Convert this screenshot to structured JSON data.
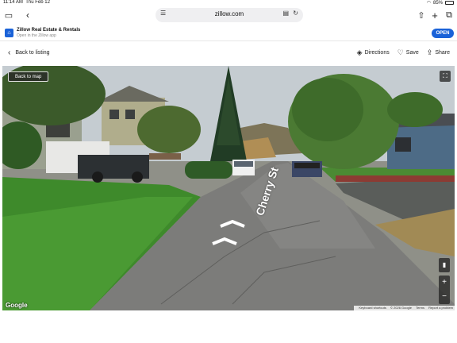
{
  "status": {
    "time": "11:14 AM",
    "date": "Thu Feb 12",
    "battery": "85%"
  },
  "browser": {
    "url": "zillow.com",
    "icons": [
      "sidebar-icon",
      "back-chevron-icon",
      "tabs-icon",
      "reader-icon",
      "reload-icon",
      "share-icon",
      "add-tab-icon",
      "tab-overview-icon"
    ]
  },
  "banner": {
    "app_title": "Zillow Real Estate & Rentals",
    "app_subtitle": "Open in the Zillow app",
    "open_label": "OPEN",
    "accent": "#1a62d8"
  },
  "nav": {
    "back_label": "Back to listing",
    "directions_label": "Directions",
    "save_label": "Save",
    "share_label": "Share"
  },
  "streetview": {
    "back_to_map_label": "Back to map",
    "street_name": "Cherry St",
    "google_label": "Google",
    "attribution": {
      "shortcuts": "Keyboard shortcuts",
      "copyright": "© 2026 Google",
      "terms": "Terms",
      "report": "Report a problem"
    },
    "zoom_in": "+",
    "zoom_out": "−"
  }
}
